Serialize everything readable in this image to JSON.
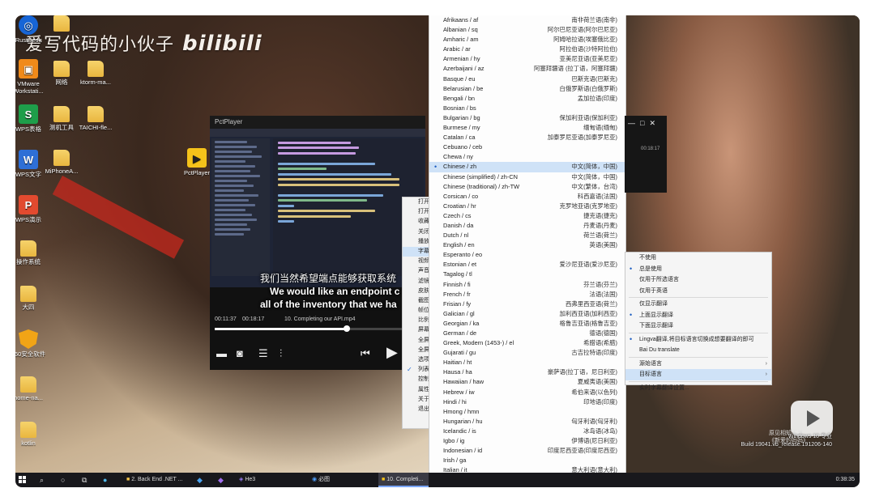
{
  "watermark": {
    "text": "爱写代码的小伙子",
    "logo": "bilibili"
  },
  "desktop_icons": [
    {
      "label": "RustDesk",
      "icon": "rustdesk-icon"
    },
    {
      "label": "VMware Workstati...",
      "icon": "vmware-icon"
    },
    {
      "label": "WPS表格",
      "icon": "wps-sheets-icon"
    },
    {
      "label": "WPS文字",
      "icon": "wps-writer-icon"
    },
    {
      "label": "WPS演示",
      "icon": "wps-presentation-icon"
    },
    {
      "label": "操作系统",
      "icon": "folder-icon"
    },
    {
      "label": "大四",
      "icon": "folder-icon"
    },
    {
      "label": "360安全软件",
      "icon": "shield-icon"
    },
    {
      "label": "home-na...",
      "icon": "folder-icon"
    },
    {
      "label": "kotlin",
      "icon": "folder-icon"
    },
    {
      "label": "网络",
      "icon": "folder-icon"
    },
    {
      "label": "ktorm-ma...",
      "icon": "folder-icon"
    },
    {
      "label": "测机工具",
      "icon": "folder-icon"
    },
    {
      "label": "TAICHI-fle...",
      "icon": "folder-icon"
    },
    {
      "label": "MiPhoneA...",
      "icon": "folder-icon"
    },
    {
      "label": "PctPlayer",
      "icon": "pctplayer-icon"
    }
  ],
  "player": {
    "title": "PctPlayer",
    "subtitle_zh": "我们当然希望端点能够获取系统",
    "subtitle_en_1": "We would like an endpoint c",
    "subtitle_en_2": "all of the inventory that we ha",
    "time_current": "00:11:37",
    "time_total": "00:18:17",
    "file": "10. Completing our API.mp4",
    "progress": 0.64,
    "controls": [
      "screen-icon",
      "camera-icon",
      "playlist-icon",
      "equalizer-icon",
      "prev-icon",
      "play-icon"
    ]
  },
  "context_menu": {
    "items": [
      {
        "label": "打开"
      },
      {
        "label": "打开"
      },
      {
        "label": "收藏"
      },
      {
        "label": "关闭"
      },
      {
        "label": "播放"
      },
      {
        "label": "字幕",
        "selected": true
      },
      {
        "label": "视频"
      },
      {
        "label": "声音"
      },
      {
        "label": "滤镜"
      },
      {
        "label": "皮肤"
      },
      {
        "label": "截图"
      },
      {
        "label": "帧位"
      },
      {
        "label": "比例"
      },
      {
        "label": "屏幕"
      },
      {
        "label": "全屏"
      },
      {
        "label": "全屏"
      },
      {
        "label": "选项"
      },
      {
        "label": "列表",
        "checked": true
      },
      {
        "label": "控制"
      },
      {
        "label": "属性"
      },
      {
        "label": "关于"
      },
      {
        "label": "退出"
      }
    ]
  },
  "languages": [
    {
      "en": "Afrikaans / af",
      "zh": "南非荷兰语(南非)"
    },
    {
      "en": "Albanian / sq",
      "zh": "阿尔巴尼亚语(阿尔巴尼亚)"
    },
    {
      "en": "Amharic / am",
      "zh": "阿姆哈拉语(埃塞俄比亚)"
    },
    {
      "en": "Arabic / ar",
      "zh": "阿拉伯语(沙特阿拉伯)"
    },
    {
      "en": "Armenian / hy",
      "zh": "亚美尼亚语(亚美尼亚)"
    },
    {
      "en": "Azerbaijani / az",
      "zh": "阿塞拜疆语 (拉丁语，阿塞拜疆)"
    },
    {
      "en": "Basque / eu",
      "zh": "巴斯克语(巴斯克)"
    },
    {
      "en": "Belarusian / be",
      "zh": "白俄罗斯语(白俄罗斯)"
    },
    {
      "en": "Bengali / bn",
      "zh": "孟加拉语(印度)"
    },
    {
      "en": "Bosnian / bs",
      "zh": ""
    },
    {
      "en": "Bulgarian / bg",
      "zh": "保加利亚语(保加利亚)"
    },
    {
      "en": "Burmese / my",
      "zh": "缅甸语(缅甸)"
    },
    {
      "en": "Catalan / ca",
      "zh": "加泰罗尼亚语(加泰罗尼亚)"
    },
    {
      "en": "Cebuano / ceb",
      "zh": ""
    },
    {
      "en": "Chewa / ny",
      "zh": ""
    },
    {
      "en": "Chinese / zh",
      "zh": "中文(简体，中国)",
      "selected": true
    },
    {
      "en": "Chinese (simplified) / zh-CN",
      "zh": "中文(简体，中国)"
    },
    {
      "en": "Chinese (traditional) / zh-TW",
      "zh": "中文(繁体，台湾)"
    },
    {
      "en": "Corsican / co",
      "zh": "科西嘉语(法国)"
    },
    {
      "en": "Croatian / hr",
      "zh": "克罗地亚语(克罗地亚)"
    },
    {
      "en": "Czech / cs",
      "zh": "捷克语(捷克)"
    },
    {
      "en": "Danish / da",
      "zh": "丹麦语(丹麦)"
    },
    {
      "en": "Dutch / nl",
      "zh": "荷兰语(荷兰)"
    },
    {
      "en": "English / en",
      "zh": "英语(美国)"
    },
    {
      "en": "Esperanto / eo",
      "zh": ""
    },
    {
      "en": "Estonian / et",
      "zh": "爱沙尼亚语(爱沙尼亚)"
    },
    {
      "en": "Tagalog / tl",
      "zh": ""
    },
    {
      "en": "Finnish / fi",
      "zh": "芬兰语(芬兰)"
    },
    {
      "en": "French / fr",
      "zh": "法语(法国)"
    },
    {
      "en": "Frisian / fy",
      "zh": "西弗里西亚语(荷兰)"
    },
    {
      "en": "Galician / gl",
      "zh": "加利西亚语(加利西亚)"
    },
    {
      "en": "Georgian / ka",
      "zh": "格鲁吉亚语(格鲁吉亚)"
    },
    {
      "en": "German / de",
      "zh": "德语(德国)"
    },
    {
      "en": "Greek, Modern (1453-) / el",
      "zh": "希腊语(希腊)"
    },
    {
      "en": "Gujarati / gu",
      "zh": "古吉拉特语(印度)"
    },
    {
      "en": "Haitian / ht",
      "zh": ""
    },
    {
      "en": "Hausa / ha",
      "zh": "豪萨语(拉丁语，尼日利亚)"
    },
    {
      "en": "Hawaiian / haw",
      "zh": "夏威夷语(美国)"
    },
    {
      "en": "Hebrew / iw",
      "zh": "希伯来语(以色列)"
    },
    {
      "en": "Hindi / hi",
      "zh": "印地语(印度)"
    },
    {
      "en": "Hmong / hmn",
      "zh": ""
    },
    {
      "en": "Hungarian / hu",
      "zh": "匈牙利语(匈牙利)"
    },
    {
      "en": "Icelandic / is",
      "zh": "冰岛语(冰岛)"
    },
    {
      "en": "Igbo / ig",
      "zh": "伊博语(尼日利亚)"
    },
    {
      "en": "Indonesian / id",
      "zh": "印度尼西亚语(印度尼西亚)"
    },
    {
      "en": "Irish / ga",
      "zh": ""
    },
    {
      "en": "Italian / it",
      "zh": "意大利语(意大利)"
    }
  ],
  "right_player": {
    "time": "00:18:17"
  },
  "sub_menu": {
    "items": [
      {
        "label": "不使用"
      },
      {
        "label": "总是使用",
        "dot": true
      },
      {
        "label": "仅用于所选语言"
      },
      {
        "label": "仅用于英语"
      },
      {
        "sep": true
      },
      {
        "label": "仅显示翻译"
      },
      {
        "label": "上面显示翻译",
        "dot": true
      },
      {
        "label": "下面显示翻译"
      },
      {
        "sep": true
      },
      {
        "label": "Lingva翻译,将目标语言切换成想要翻译的即可",
        "dot": true
      },
      {
        "label": "Bai Du translate"
      },
      {
        "sep": true
      },
      {
        "label": "源始语言",
        "arrow": true
      },
      {
        "label": "目标语言",
        "arrow": true,
        "selected": true
      },
      {
        "sep": true
      },
      {
        "label": "实时字幕翻译设置..."
      }
    ]
  },
  "taskbar": {
    "items": [
      {
        "label": "2. Back End .NET ..."
      },
      {
        "label": "He3"
      },
      {
        "label": "必图"
      },
      {
        "label": "10. Completi...",
        "active": true
      }
    ],
    "clock": "0:38:35"
  },
  "windows_mark": {
    "line1": "Windows 10 专业",
    "line2": "Build 19041.vb_release.191206-140"
  },
  "right_caption": {
    "line1": "原见相知不当",
    "line2": "《新爱的妈妈》"
  }
}
